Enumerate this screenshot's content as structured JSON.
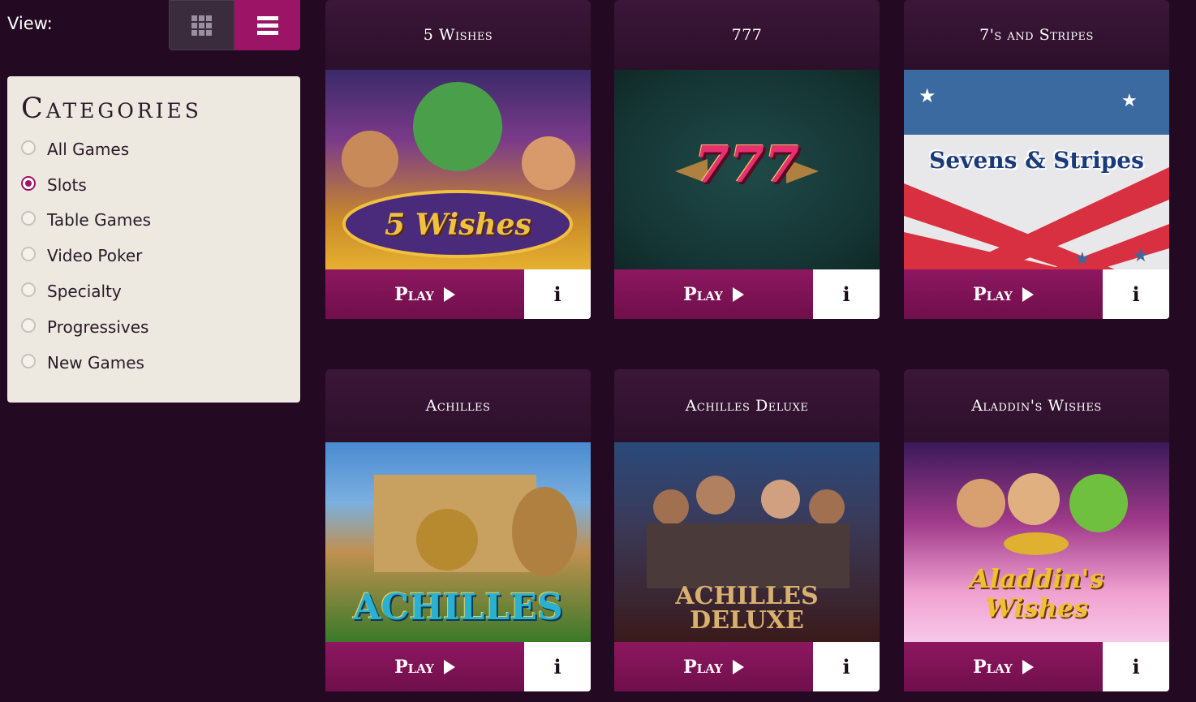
{
  "view": {
    "label": "View:"
  },
  "categories": {
    "title": "Categories",
    "items": [
      {
        "label": "All Games",
        "checked": false
      },
      {
        "label": "Slots",
        "checked": true
      },
      {
        "label": "Table Games",
        "checked": false
      },
      {
        "label": "Video Poker",
        "checked": false
      },
      {
        "label": "Specialty",
        "checked": false
      },
      {
        "label": "Progressives",
        "checked": false
      },
      {
        "label": "New Games",
        "checked": false
      }
    ]
  },
  "games": [
    {
      "title": "5 Wishes",
      "art_text": "5 Wishes",
      "play_label": "Play",
      "info_label": "i"
    },
    {
      "title": "777",
      "art_text": "777",
      "play_label": "Play",
      "info_label": "i"
    },
    {
      "title": "7's and Stripes",
      "art_text": "Sevens & Stripes",
      "play_label": "Play",
      "info_label": "i"
    },
    {
      "title": "Achilles",
      "art_text": "ACHILLES",
      "play_label": "Play",
      "info_label": "i"
    },
    {
      "title": "Achilles Deluxe",
      "art_text": "ACHILLES DELUXE",
      "play_label": "Play",
      "info_label": "i"
    },
    {
      "title": "Aladdin's Wishes",
      "art_text": "Aladdin's Wishes",
      "play_label": "Play",
      "info_label": "i"
    }
  ],
  "colors": {
    "accent": "#9c1466",
    "background": "#230a22",
    "panel": "#ede9e0"
  }
}
